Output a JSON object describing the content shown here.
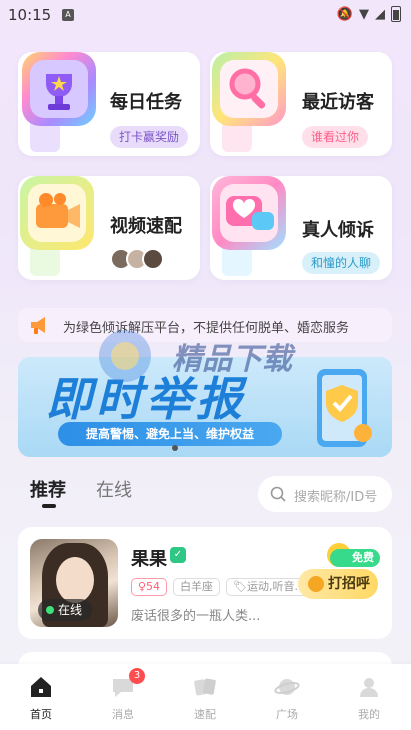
{
  "status_bar": {
    "time": "10:15"
  },
  "features": [
    {
      "title": "每日任务",
      "tag": "打卡赢奖励",
      "icon": "trophy-icon",
      "tag_bg": "#e9dcfb",
      "tag_color": "#7a56c6"
    },
    {
      "title": "最近访客",
      "tag": "谁看过你",
      "icon": "magnifier-icon",
      "tag_bg": "#ffe0ea",
      "tag_color": "#ff5f8a"
    },
    {
      "title": "视频速配",
      "tag": "",
      "icon": "video-camera-icon",
      "tag_bg": "",
      "tag_color": ""
    },
    {
      "title": "真人倾诉",
      "tag": "和憧的人聊",
      "icon": "heart-chat-icon",
      "tag_bg": "#d8f0fa",
      "tag_color": "#2b9bc8"
    }
  ],
  "notice": {
    "text": "为绿色倾诉解压平台，不提供任何脱单、婚恋服务"
  },
  "banner": {
    "title": "即时举报",
    "subtitle": "提高警惕、避免上当、维护权益"
  },
  "watermark": {
    "text": "精品下载"
  },
  "tabs": {
    "recommended": "推荐",
    "online": "在线"
  },
  "search": {
    "placeholder": "搜索昵称/ID号"
  },
  "user": {
    "name": "果果",
    "online_label": "在线",
    "chips": [
      "♀54",
      "白羊座",
      "🏷运动,听音..."
    ],
    "bio": "废话很多的一瓶人类...",
    "free_label": "免费",
    "greet_label": "打招呼"
  },
  "bottom_nav": [
    {
      "label": "首页",
      "icon": "home-icon",
      "active": true
    },
    {
      "label": "消息",
      "icon": "message-icon",
      "badge": "3"
    },
    {
      "label": "速配",
      "icon": "match-cards-icon"
    },
    {
      "label": "广场",
      "icon": "planet-icon"
    },
    {
      "label": "我的",
      "icon": "profile-icon"
    }
  ],
  "colors": {
    "accent": "#222222",
    "banner_blue": "#1e7fd8",
    "online_green": "#3ee07a",
    "badge_red": "#ff4d4f"
  }
}
